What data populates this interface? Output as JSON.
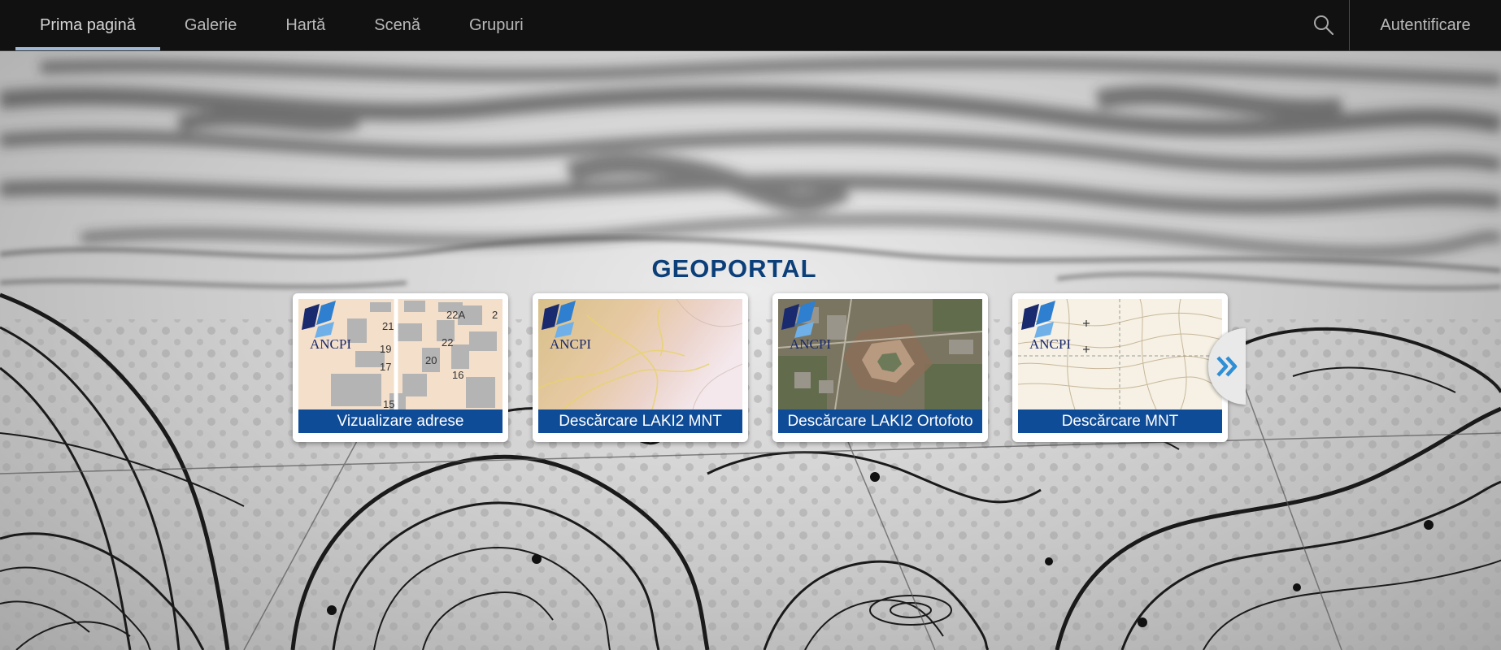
{
  "nav": {
    "tabs": [
      {
        "label": "Prima pagină",
        "active": true
      },
      {
        "label": "Galerie",
        "active": false
      },
      {
        "label": "Hartă",
        "active": false
      },
      {
        "label": "Scenă",
        "active": false
      },
      {
        "label": "Grupuri",
        "active": false
      }
    ],
    "search_icon": "search-icon",
    "login_label": "Autentificare"
  },
  "hero": {
    "title": "GEOPORTAL"
  },
  "cards": [
    {
      "caption": "Vizualizare adrese",
      "logo": "ANCPI"
    },
    {
      "caption": "Descărcare LAKI2 MNT",
      "logo": "ANCPI"
    },
    {
      "caption": "Descărcare LAKI2 Ortofoto",
      "logo": "ANCPI"
    },
    {
      "caption": "Descărcare MNT",
      "logo": "ANCPI"
    }
  ],
  "address_map_numbers": [
    "21",
    "22A",
    "2",
    "19",
    "22",
    "17",
    "20",
    "16",
    "15"
  ],
  "carousel": {
    "next_icon": "double-chevron-right-icon"
  },
  "colors": {
    "nav_bg": "#111111",
    "active_underline": "#9eb8d6",
    "title": "#0b3f7a",
    "caption_bg": "#0f4c97",
    "chevron": "#2f8fd6"
  }
}
